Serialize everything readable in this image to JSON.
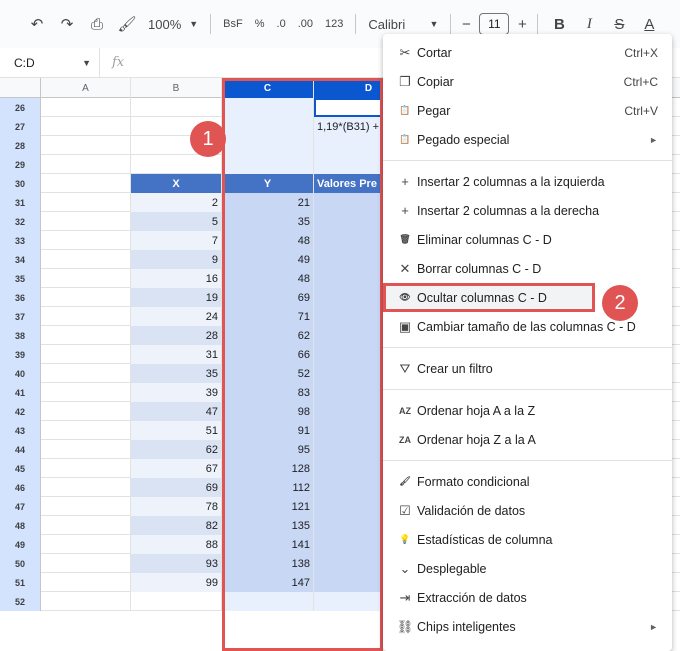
{
  "toolbar": {
    "zoom": "100%",
    "currency_label": "BsF",
    "percent_label": "%",
    "dec_decrease": ".0",
    "dec_increase": ".00",
    "format_123": "123",
    "font_name": "Calibri",
    "font_size": "11",
    "bold": "B",
    "italic": "I",
    "strike": "S",
    "text_color": "A"
  },
  "formula_bar": {
    "name_box": "C:D",
    "fx": "fx"
  },
  "columns": [
    "A",
    "B",
    "C",
    "D"
  ],
  "rows": [
    {
      "num": "26",
      "b": "",
      "c": "",
      "d": ""
    },
    {
      "num": "27",
      "b": "",
      "c": "",
      "d": "1,19*(B31) +"
    },
    {
      "num": "28",
      "b": "",
      "c": "",
      "d": ""
    },
    {
      "num": "29",
      "b": "",
      "c": "",
      "d": ""
    },
    {
      "num": "30",
      "b": "X",
      "c": "Y",
      "d": "Valores Pre"
    },
    {
      "num": "31",
      "b": "2",
      "c": "21",
      "d": ""
    },
    {
      "num": "32",
      "b": "5",
      "c": "35",
      "d": ""
    },
    {
      "num": "33",
      "b": "7",
      "c": "48",
      "d": ""
    },
    {
      "num": "34",
      "b": "9",
      "c": "49",
      "d": ""
    },
    {
      "num": "35",
      "b": "16",
      "c": "48",
      "d": ""
    },
    {
      "num": "36",
      "b": "19",
      "c": "69",
      "d": ""
    },
    {
      "num": "37",
      "b": "24",
      "c": "71",
      "d": ""
    },
    {
      "num": "38",
      "b": "28",
      "c": "62",
      "d": ""
    },
    {
      "num": "39",
      "b": "31",
      "c": "66",
      "d": ""
    },
    {
      "num": "40",
      "b": "35",
      "c": "52",
      "d": ""
    },
    {
      "num": "41",
      "b": "39",
      "c": "83",
      "d": ""
    },
    {
      "num": "42",
      "b": "47",
      "c": "98",
      "d": ""
    },
    {
      "num": "43",
      "b": "51",
      "c": "91",
      "d": ""
    },
    {
      "num": "44",
      "b": "62",
      "c": "95",
      "d": ""
    },
    {
      "num": "45",
      "b": "67",
      "c": "128",
      "d": ""
    },
    {
      "num": "46",
      "b": "69",
      "c": "112",
      "d": ""
    },
    {
      "num": "47",
      "b": "78",
      "c": "121",
      "d": ""
    },
    {
      "num": "48",
      "b": "82",
      "c": "135",
      "d": ""
    },
    {
      "num": "49",
      "b": "88",
      "c": "141",
      "d": ""
    },
    {
      "num": "50",
      "b": "93",
      "c": "138",
      "d": ""
    },
    {
      "num": "51",
      "b": "99",
      "c": "147",
      "d": ""
    },
    {
      "num": "52",
      "b": "",
      "c": "",
      "d": ""
    }
  ],
  "badges": {
    "one": "1",
    "two": "2"
  },
  "menu": [
    {
      "icon": "✂",
      "icon_name": "scissors-icon",
      "label": "Cortar",
      "shortcut": "Ctrl+X"
    },
    {
      "icon": "❐",
      "icon_name": "copy-icon",
      "label": "Copiar",
      "shortcut": "Ctrl+C"
    },
    {
      "icon": "📋",
      "icon_name": "clipboard-icon",
      "label": "Pegar",
      "shortcut": "Ctrl+V"
    },
    {
      "icon": "📋",
      "icon_name": "clipboard-special-icon",
      "label": "Pegado especial",
      "arrow": "►"
    },
    {
      "sep": true
    },
    {
      "icon": "+",
      "icon_name": "plus-icon",
      "label": "Insertar 2 columnas a la izquierda"
    },
    {
      "icon": "+",
      "icon_name": "plus-icon",
      "label": "Insertar 2 columnas a la derecha"
    },
    {
      "icon": "🗑",
      "icon_name": "trash-icon",
      "label": "Eliminar columnas C - D"
    },
    {
      "icon": "✕",
      "icon_name": "close-icon",
      "label": "Borrar columnas C - D"
    },
    {
      "icon": "👁",
      "icon_name": "eye-off-icon",
      "label": "Ocultar columnas C - D",
      "highlight": true
    },
    {
      "icon": "▣",
      "icon_name": "resize-icon",
      "label": "Cambiar tamaño de las columnas C - D"
    },
    {
      "sep": true
    },
    {
      "icon": "⛛",
      "icon_name": "filter-icon",
      "label": "Crear un filtro"
    },
    {
      "sep": true
    },
    {
      "icon": "AZ",
      "icon_name": "sort-az-icon",
      "label": "Ordenar hoja A a la Z"
    },
    {
      "icon": "ZA",
      "icon_name": "sort-za-icon",
      "label": "Ordenar hoja Z a la A"
    },
    {
      "sep": true
    },
    {
      "icon": "🖌",
      "icon_name": "paint-roller-icon",
      "label": "Formato condicional"
    },
    {
      "icon": "☑",
      "icon_name": "validation-icon",
      "label": "Validación de datos"
    },
    {
      "icon": "💡",
      "icon_name": "lightbulb-icon",
      "label": "Estadísticas de columna"
    },
    {
      "icon": "⌄",
      "icon_name": "dropdown-icon",
      "label": "Desplegable"
    },
    {
      "icon": "⇥",
      "icon_name": "data-extract-icon",
      "label": "Extracción de datos"
    },
    {
      "icon": "⛓",
      "icon_name": "smart-chips-icon",
      "label": "Chips inteligentes",
      "arrow": "►"
    }
  ]
}
